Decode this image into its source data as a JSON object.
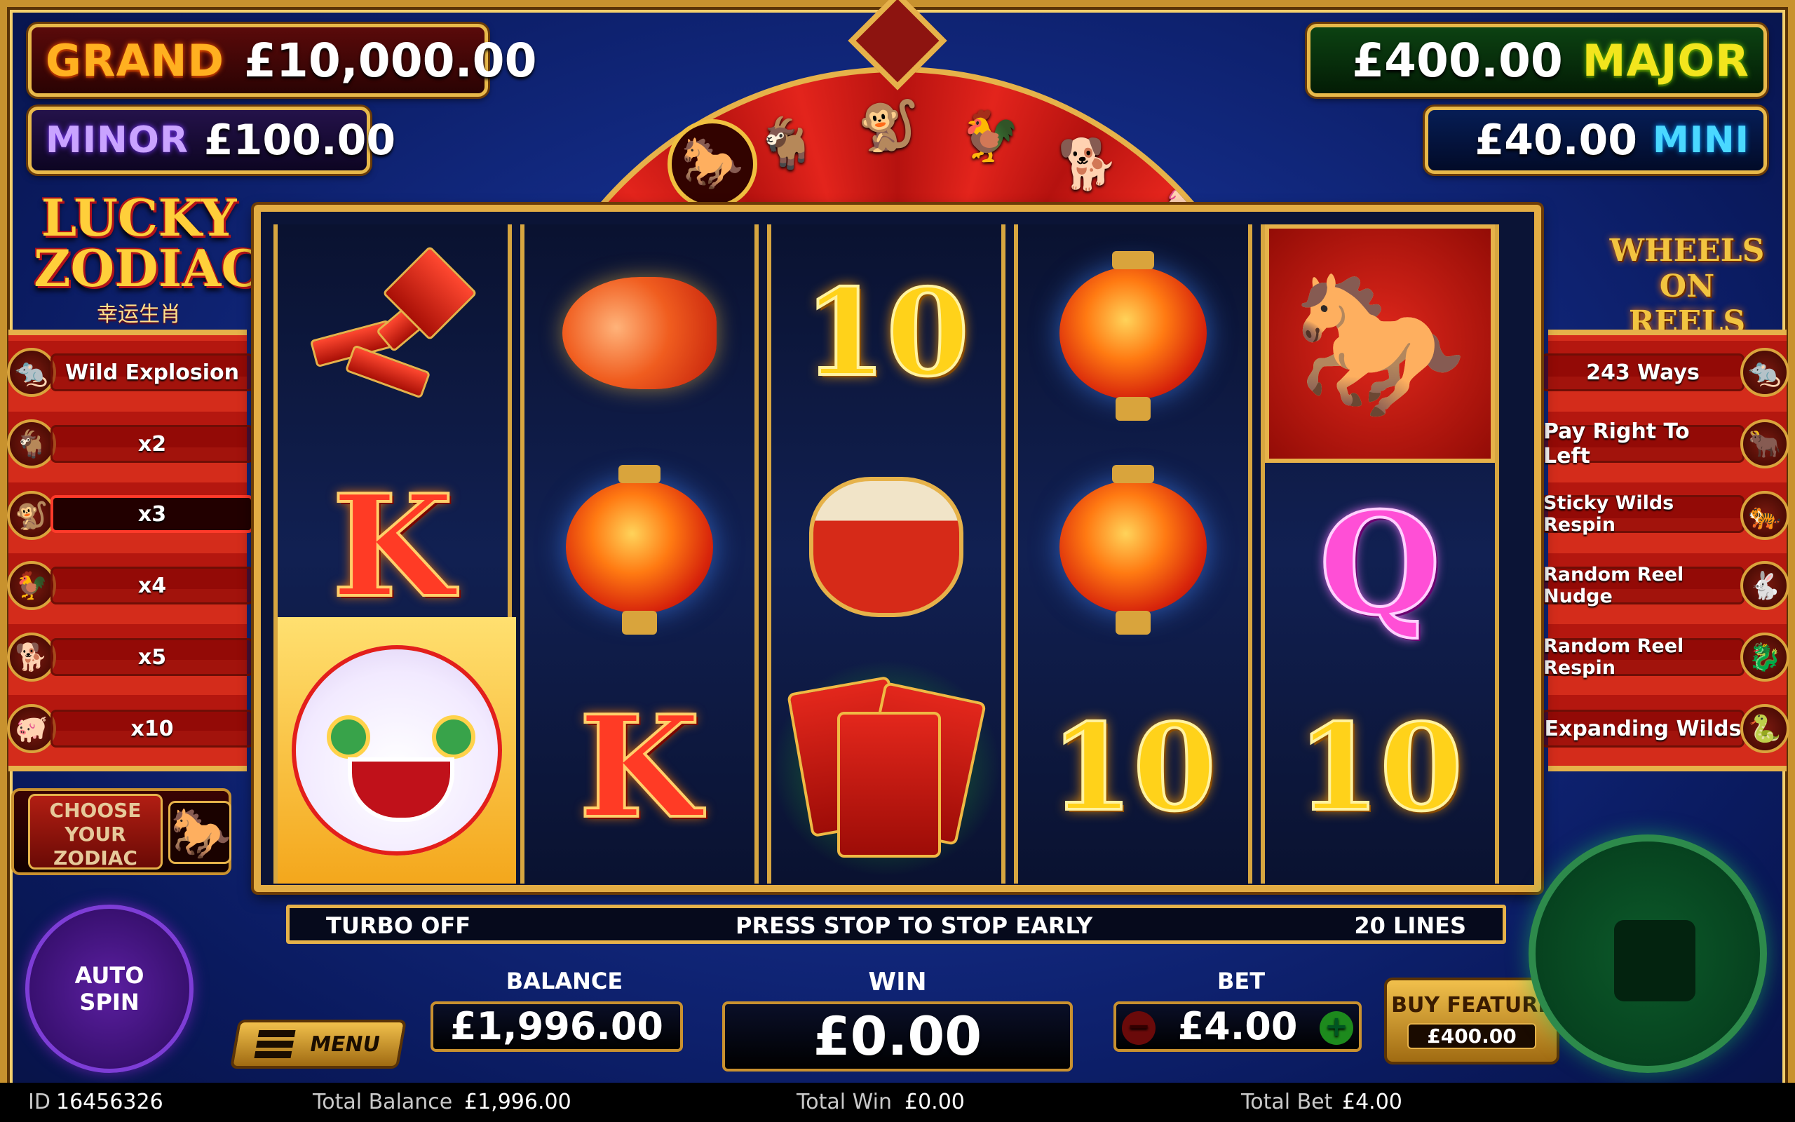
{
  "jackpots": {
    "grand": {
      "label": "GRAND",
      "value": "£10,000.00"
    },
    "minor": {
      "label": "MINOR",
      "value": "£100.00"
    },
    "major": {
      "label": "MAJOR",
      "value": "£400.00"
    },
    "mini": {
      "label": "MINI",
      "value": "£40.00"
    }
  },
  "logo_left": {
    "line1": "LUCKY",
    "line2": "ZODIAC",
    "line3": "幸运生肖"
  },
  "logo_right": {
    "text": "WHEELS ON REELS"
  },
  "left_features": [
    {
      "icon": "rat-icon",
      "label": "Wild Explosion",
      "active": false
    },
    {
      "icon": "goat-icon",
      "label": "x2",
      "active": false
    },
    {
      "icon": "monkey-icon",
      "label": "x3",
      "active": true
    },
    {
      "icon": "rooster-icon",
      "label": "x4",
      "active": false
    },
    {
      "icon": "dog-icon",
      "label": "x5",
      "active": false
    },
    {
      "icon": "pig-icon",
      "label": "x10",
      "active": false
    }
  ],
  "right_features": [
    {
      "icon": "rat-icon",
      "label": "243 Ways"
    },
    {
      "icon": "ox-icon",
      "label": "Pay Right To Left"
    },
    {
      "icon": "tiger-icon",
      "label": "Sticky Wilds Respin"
    },
    {
      "icon": "rabbit-icon",
      "label": "Random Reel Nudge"
    },
    {
      "icon": "dragon-icon",
      "label": "Random Reel Respin"
    },
    {
      "icon": "snake-icon",
      "label": "Expanding Wilds"
    }
  ],
  "reels": [
    [
      "firecrackers",
      "K",
      "lion-dance"
    ],
    [
      "koi-fish",
      "lantern",
      "K"
    ],
    [
      "10",
      "drum",
      "red-envelopes"
    ],
    [
      "lantern",
      "lantern",
      "10"
    ],
    [
      "golden-horse",
      "Q",
      "10"
    ]
  ],
  "info_bar": {
    "left": "TURBO OFF",
    "center": "PRESS STOP TO STOP EARLY",
    "right": "20 LINES"
  },
  "choose_zodiac": {
    "label": "CHOOSE YOUR ZODIAC"
  },
  "autospin": {
    "label": "AUTO SPIN"
  },
  "menu": {
    "label": "MENU"
  },
  "balance": {
    "label": "BALANCE",
    "value": "£1,996.00"
  },
  "win": {
    "label": "WIN",
    "value": "£0.00"
  },
  "bet": {
    "label": "BET",
    "value": "£4.00"
  },
  "buy_feature": {
    "label": "BUY FEATURE",
    "price": "£400.00"
  },
  "status": {
    "id_label": "ID",
    "id_value": "16456326",
    "total_balance_label": "Total Balance",
    "total_balance_value": "£1,996.00",
    "total_win_label": "Total Win",
    "total_win_value": "£0.00",
    "total_bet_label": "Total Bet",
    "total_bet_value": "£4.00"
  },
  "colors": {
    "gold": "#e6b24a",
    "red": "#d42c1b",
    "navy": "#0c1a55",
    "spin_green": "#0c5a2a",
    "autospin_purple": "#5b1fa0"
  }
}
